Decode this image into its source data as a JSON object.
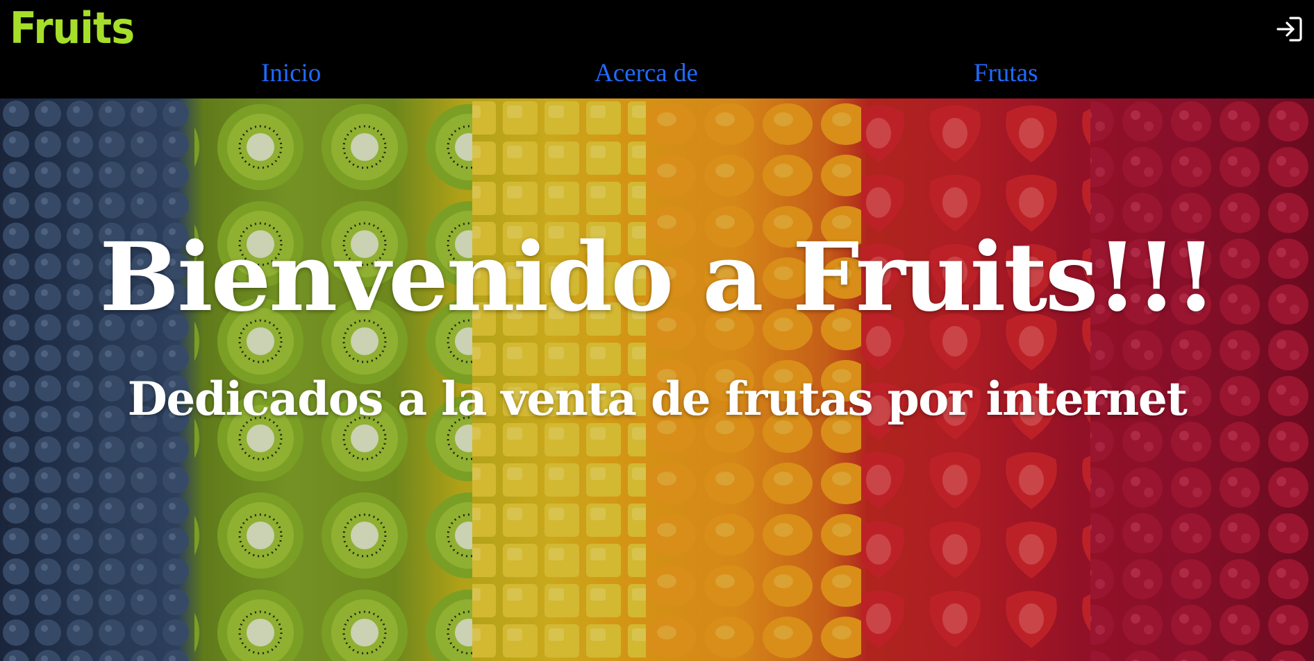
{
  "header": {
    "logo_text": "Fruits",
    "logo_color": "#a6df2a",
    "login_icon": "login-icon"
  },
  "nav": {
    "items": [
      {
        "label": "Inicio"
      },
      {
        "label": "Acerca de"
      },
      {
        "label": "Frutas"
      }
    ],
    "link_color": "#1f6bff"
  },
  "hero": {
    "title": "Bienvenido a Fruits!!!",
    "subtitle": "Dedicados a la venta de frutas por internet",
    "background": "fruit-stripes-image",
    "stripes": [
      "blueberries",
      "kiwi",
      "pineapple",
      "mandarin",
      "strawberries",
      "raspberries"
    ]
  }
}
